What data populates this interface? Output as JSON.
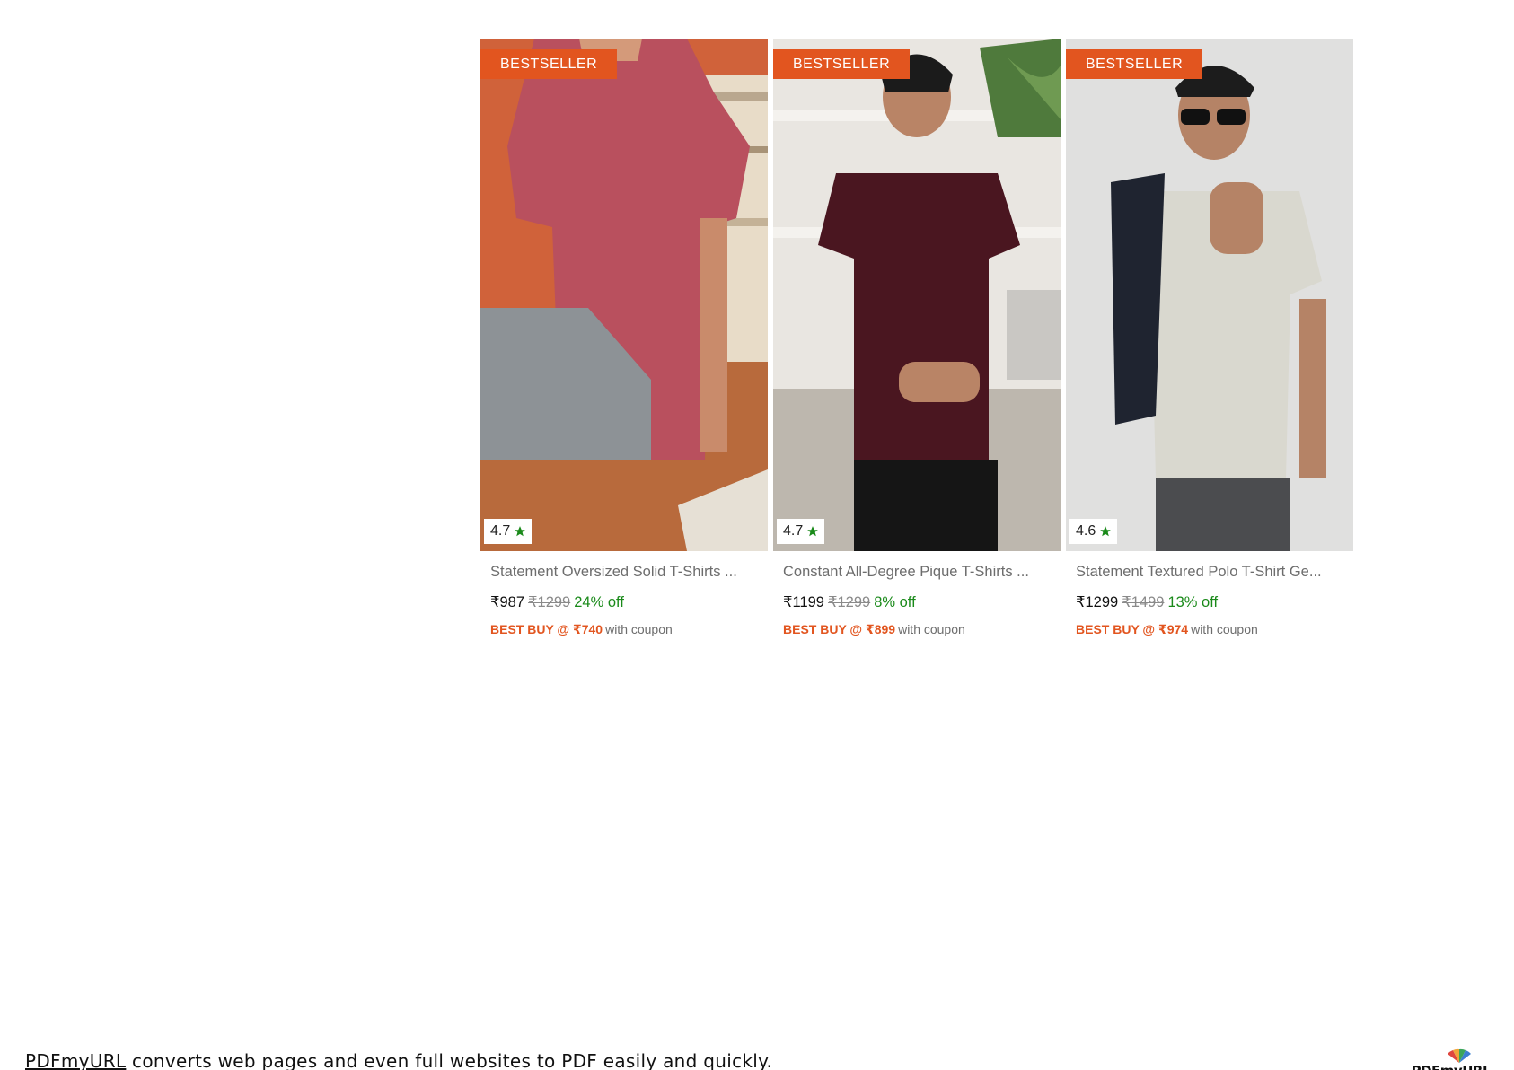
{
  "products": [
    {
      "badge": "BESTSELLER",
      "rating": "4.7",
      "title": "Statement Oversized Solid T-Shirts ...",
      "price": "₹987",
      "mrp": "₹1299",
      "discount": "24% off",
      "best_buy": "BEST BUY @ ₹740",
      "best_buy_note": "with coupon"
    },
    {
      "badge": "BESTSELLER",
      "rating": "4.7",
      "title": "Constant All-Degree Pique T-Shirts ...",
      "price": "₹1199",
      "mrp": "₹1299",
      "discount": "8% off",
      "best_buy": "BEST BUY @ ₹899",
      "best_buy_note": "with coupon"
    },
    {
      "badge": "BESTSELLER",
      "rating": "4.6",
      "title": "Statement Textured Polo T-Shirt Ge...",
      "price": "₹1299",
      "mrp": "₹1499",
      "discount": "13% off",
      "best_buy": "BEST BUY @ ₹974",
      "best_buy_note": "with coupon"
    }
  ],
  "footer": {
    "link_text": "PDFmyURL",
    "text": " converts web pages and even full websites to PDF easily and quickly.",
    "logo_text": "PDFmyURL"
  },
  "colors": {
    "badge": "#e2551f",
    "discount": "#1a8a1a",
    "star": "#1a8a1a"
  }
}
